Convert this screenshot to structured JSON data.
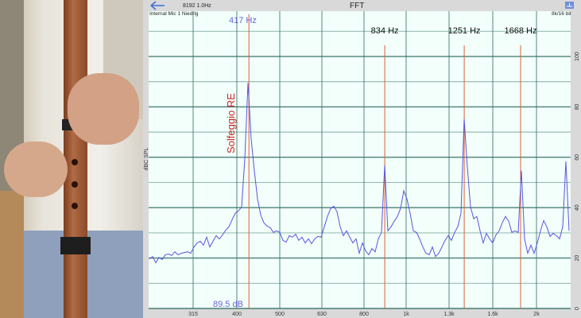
{
  "header": {
    "title": "FFT",
    "fft_info": "8192  1.0Hz",
    "input_source": "Internal Mic 1 Niedrig",
    "format": "8k/16 bit",
    "back_icon": "arrow-left-icon",
    "share_icon": "share-icon"
  },
  "colors": {
    "spectrum": "#5a55e0",
    "marker": "#d9603a",
    "peak_label": "#6a66d8",
    "annotation": "#cc2222",
    "plot_bg": "#f2fffa",
    "grid": "#2f6a62"
  },
  "chart_data": {
    "type": "line",
    "title": "FFT",
    "xlabel": "",
    "ylabel": "dBC SPL",
    "x_scale": "log",
    "ylim": [
      0,
      118
    ],
    "y_ticks": [
      "0",
      "20",
      "40",
      "60",
      "80",
      "100"
    ],
    "x_ticks": [
      "315",
      "400",
      "500",
      "630",
      "800",
      "1k",
      "1.3k",
      "1.6k",
      "2k"
    ],
    "grid": true,
    "peak_label": "417 Hz",
    "peak_level_label": "89.5 dB",
    "annotation": "Solfeggio RE",
    "markers": [
      {
        "freq": 417,
        "label": "417 Hz"
      },
      {
        "freq": 834,
        "label": "834 Hz"
      },
      {
        "freq": 1251,
        "label": "1251 Hz"
      },
      {
        "freq": 1668,
        "label": "1668 Hz"
      }
    ],
    "series": [
      {
        "name": "spectrum",
        "freq_range": [
          251,
          2136
        ],
        "spacing": "log",
        "values": [
          19.7,
          20.6,
          18.1,
          20.3,
          19.4,
          21.3,
          21.6,
          21.0,
          22.5,
          21.3,
          21.9,
          22.2,
          22.5,
          21.9,
          24.4,
          26.0,
          26.7,
          25.1,
          28.3,
          24.4,
          26.7,
          28.9,
          27.6,
          29.2,
          31.1,
          32.4,
          35.2,
          37.8,
          38.7,
          40.3,
          59.4,
          89.5,
          67.3,
          54.6,
          43.5,
          37.1,
          34.0,
          32.7,
          32.1,
          30.2,
          30.8,
          30.2,
          27.0,
          26.3,
          28.9,
          28.3,
          29.5,
          27.0,
          28.3,
          26.0,
          27.6,
          25.7,
          27.6,
          28.6,
          28.3,
          32.4,
          36.5,
          39.7,
          40.6,
          38.4,
          32.4,
          28.9,
          30.8,
          28.3,
          26.0,
          27.6,
          21.9,
          26.0,
          22.9,
          21.3,
          23.8,
          22.5,
          27.6,
          30.2,
          56.8,
          30.8,
          32.4,
          34.6,
          36.5,
          39.7,
          46.7,
          43.5,
          37.8,
          30.8,
          30.2,
          27.6,
          24.4,
          21.9,
          21.3,
          24.4,
          20.6,
          21.9,
          24.4,
          27.0,
          28.9,
          27.0,
          30.2,
          32.4,
          37.8,
          75.2,
          56.2,
          40.3,
          35.6,
          36.5,
          30.8,
          26.0,
          29.8,
          27.6,
          26.0,
          29.2,
          30.8,
          34.0,
          36.5,
          34.6,
          30.2,
          30.8,
          30.2,
          54.6,
          27.6,
          21.9,
          25.1,
          21.9,
          26.0,
          30.8,
          34.9,
          32.4,
          28.6,
          29.8,
          28.9,
          27.6,
          32.4,
          58.4,
          30.8
        ]
      }
    ]
  }
}
